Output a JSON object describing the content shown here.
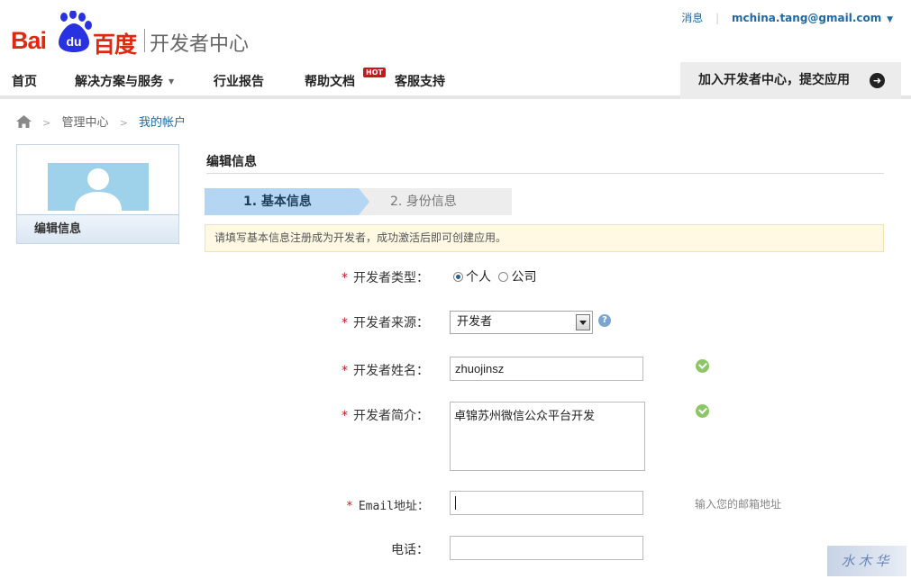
{
  "header": {
    "logo_bai": "Bai",
    "logo_du": "du",
    "logo_cn": "百度",
    "logo_sub": "开发者中心",
    "messages_label": "消息",
    "user_email": "mchina.tang@gmail.com",
    "brand_color": "#de2910"
  },
  "nav": {
    "items": [
      "首页",
      "解决方案与服务",
      "行业报告",
      "帮助文档",
      "客服支持"
    ],
    "hot_badge": "HOT",
    "join_label": "加入开发者中心，提交应用"
  },
  "breadcrumb": {
    "items": [
      "管理中心",
      "我的帐户"
    ]
  },
  "sidebar": {
    "tab_label": "编辑信息"
  },
  "main": {
    "title": "编辑信息",
    "steps": [
      "1. 基本信息",
      "2. 身份信息"
    ],
    "notice": "请填写基本信息注册成为开发者，成功激活后即可创建应用。"
  },
  "form": {
    "type_label": "开发者类型：",
    "type_options": [
      "个人",
      "公司"
    ],
    "type_selected": "个人",
    "source_label": "开发者来源：",
    "source_value": "开发者",
    "name_label": "开发者姓名：",
    "name_value": "zhuojinsz",
    "intro_label": "开发者简介：",
    "intro_value": "卓锦苏州微信公众平台开发",
    "email_label": "Email地址：",
    "email_value": "",
    "email_hint": "输入您的邮箱地址",
    "phone_label": "电话：",
    "phone_value": "",
    "required_mark": "*"
  }
}
